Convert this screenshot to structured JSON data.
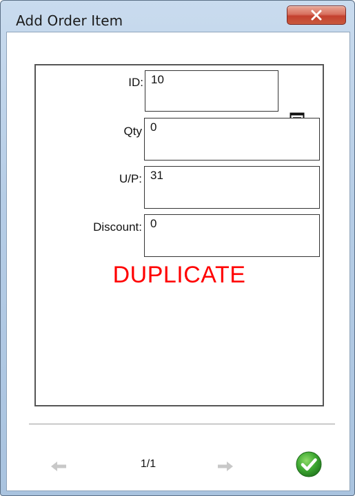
{
  "window": {
    "title": "Add Order Item"
  },
  "fields": [
    {
      "label": "ID:",
      "value": "10"
    },
    {
      "label": "Qty",
      "value": "0"
    },
    {
      "label": "U/P:",
      "value": "31"
    },
    {
      "label": "Discount:",
      "value": "0"
    }
  ],
  "status": {
    "text": "DUPLICATE",
    "color": "#ff0000"
  },
  "nav": {
    "page": "1/1"
  },
  "icons": {
    "close": "close-icon",
    "lookup": "list-icon",
    "prev": "arrow-left-icon",
    "next": "arrow-right-icon",
    "ok": "check-circle-icon"
  },
  "colors": {
    "accent_ok": "#3ea832",
    "close_button": "#c4402e"
  }
}
